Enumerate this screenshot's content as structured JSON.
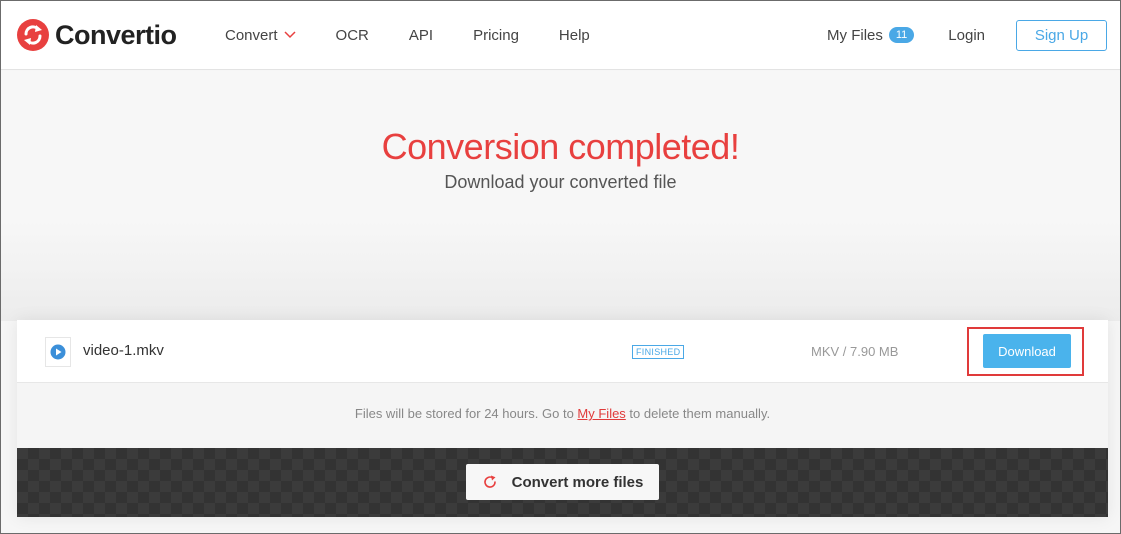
{
  "brand": {
    "name": "Convertio"
  },
  "nav": {
    "items": [
      {
        "label": "Convert",
        "has_dropdown": true
      },
      {
        "label": "OCR"
      },
      {
        "label": "API"
      },
      {
        "label": "Pricing"
      },
      {
        "label": "Help"
      }
    ],
    "my_files": {
      "label": "My Files",
      "count": "11"
    },
    "login": "Login",
    "signup": "Sign Up"
  },
  "hero": {
    "title": "Conversion completed!",
    "subtitle": "Download your converted file"
  },
  "file": {
    "name": "video-1.mkv",
    "status": "FINISHED",
    "meta": "MKV / 7.90 MB",
    "download_label": "Download"
  },
  "storage_note": {
    "before": "Files will be stored for 24 hours. Go to ",
    "link": "My Files",
    "after": " to delete them manually."
  },
  "convert_more": "Convert more files",
  "colors": {
    "brand_red": "#e8403f",
    "accent_blue": "#4aa8e6",
    "highlight_outline": "#e03a3a"
  },
  "icons": {
    "logo": "convertio-logo-icon",
    "dropdown": "chevron-down-icon",
    "file": "play-icon",
    "convert_more": "refresh-icon"
  }
}
